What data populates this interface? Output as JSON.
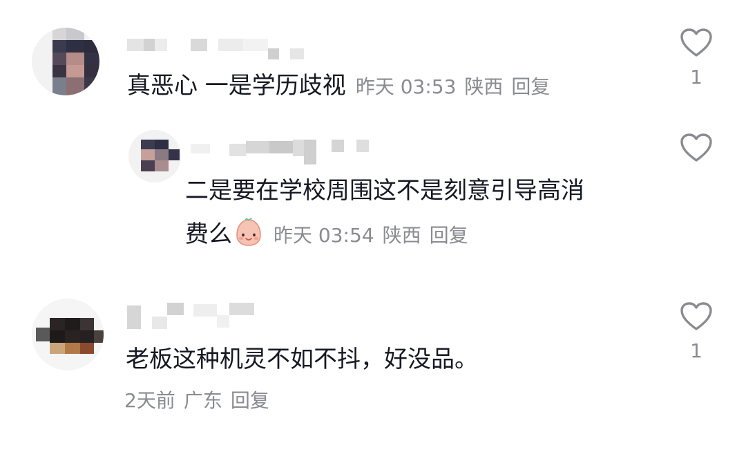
{
  "comments": [
    {
      "text": "真恶心 一是学历歧视",
      "time": "昨天 03:53",
      "location": "陕西",
      "reply_label": "回复",
      "like_count": "1"
    },
    {
      "text_line1": "二是要在学校周围这不是刻意引导高消",
      "text_line2": "费么",
      "emoji": "blushing-face-emoji",
      "time": "昨天 03:54",
      "location": "陕西",
      "reply_label": "回复",
      "like_count": ""
    },
    {
      "text": "老板这种机灵不如不抖，好没品。",
      "time": "2天前",
      "location": "广东",
      "reply_label": "回复",
      "like_count": "1"
    }
  ],
  "colors": {
    "text": "#161823",
    "meta": "#8a8b91",
    "icon": "#8a8b91",
    "background": "#ffffff"
  },
  "icons": {
    "like": "heart-outline-icon"
  }
}
